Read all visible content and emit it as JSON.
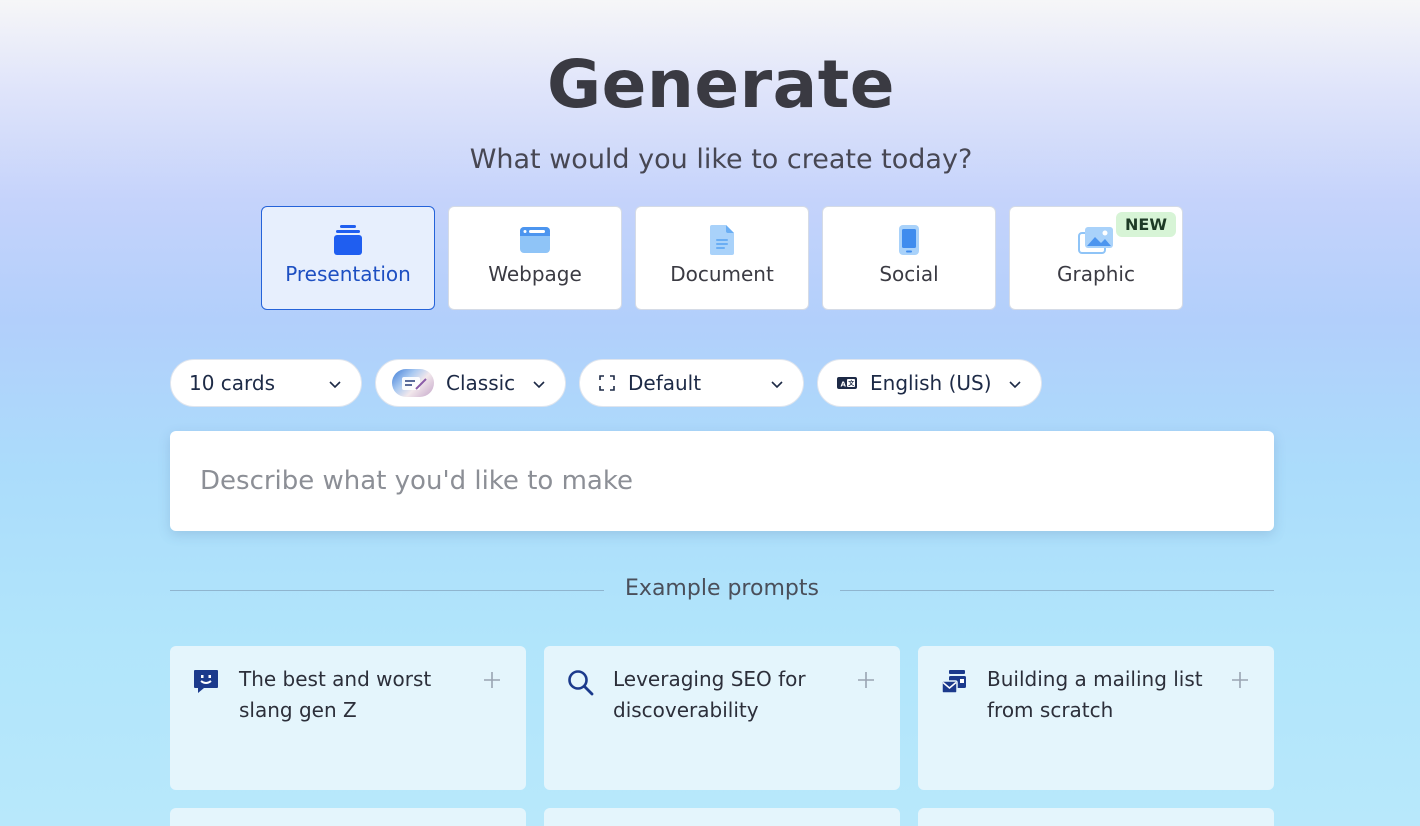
{
  "header": {
    "title": "Generate",
    "subtitle": "What would you like to create today?"
  },
  "types": [
    {
      "label": "Presentation",
      "icon": "stack-icon",
      "selected": true
    },
    {
      "label": "Webpage",
      "icon": "browser-window-icon",
      "selected": false
    },
    {
      "label": "Document",
      "icon": "document-icon",
      "selected": false
    },
    {
      "label": "Social",
      "icon": "phone-icon",
      "selected": false
    },
    {
      "label": "Graphic",
      "icon": "image-icon",
      "selected": false,
      "badge": "NEW"
    }
  ],
  "options": {
    "cards": "10 cards",
    "theme": "Classic",
    "format": "Default",
    "language": "English (US)"
  },
  "prompt": {
    "placeholder": "Describe what you'd like to make",
    "value": ""
  },
  "examples": {
    "label": "Example prompts",
    "items": [
      {
        "text": "The best and worst slang gen Z",
        "icon": "chat-smile-icon"
      },
      {
        "text": "Leveraging SEO for discoverability",
        "icon": "search-icon"
      },
      {
        "text": "Building a mailing list from scratch",
        "icon": "mail-icon"
      }
    ]
  },
  "colors": {
    "accent": "#1d4fc2",
    "selected_bg": "#e7effd",
    "icon_blue": "#2f6fe6",
    "badge_bg": "#d7f4d6"
  }
}
